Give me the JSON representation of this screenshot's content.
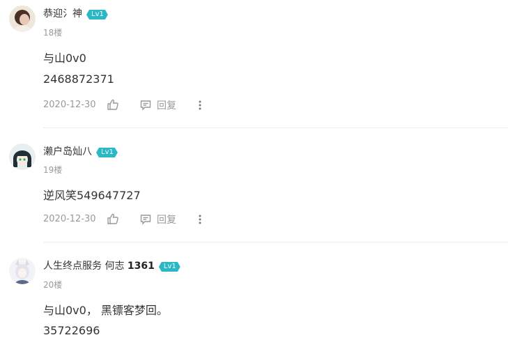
{
  "comments": [
    {
      "username": "恭迎氵神",
      "username_num": "",
      "level": "Lv1",
      "floor": "18楼",
      "lines": [
        "与山0v0",
        "2468872371"
      ],
      "date": "2020-12-30",
      "reply_label": "回复",
      "avatar_colors": [
        "#3a2a22",
        "#e6cfc0"
      ]
    },
    {
      "username": "濑户岛灿八",
      "username_num": "",
      "level": "Lv1",
      "floor": "19楼",
      "lines": [
        "逆风笑549647727"
      ],
      "date": "2020-12-30",
      "reply_label": "回复",
      "avatar_colors": [
        "#1f3a3a",
        "#f2e6d8"
      ]
    },
    {
      "username": "人生终点服务 何志",
      "username_num": "1361",
      "level": "Lv1",
      "floor": "20楼",
      "lines": [
        "与山0v0， 黑镖客梦回。",
        "35722696"
      ],
      "date": "",
      "reply_label": "",
      "avatar_colors": [
        "#d8d8e4",
        "#f4f4f8"
      ]
    }
  ],
  "colors": {
    "level_badge": "#2ab7c6",
    "muted_text": "#999999",
    "divider": "#ececec"
  },
  "icons": {
    "like": "thumbs-up-icon",
    "reply": "speech-bubble-icon",
    "more": "vertical-ellipsis-icon"
  }
}
